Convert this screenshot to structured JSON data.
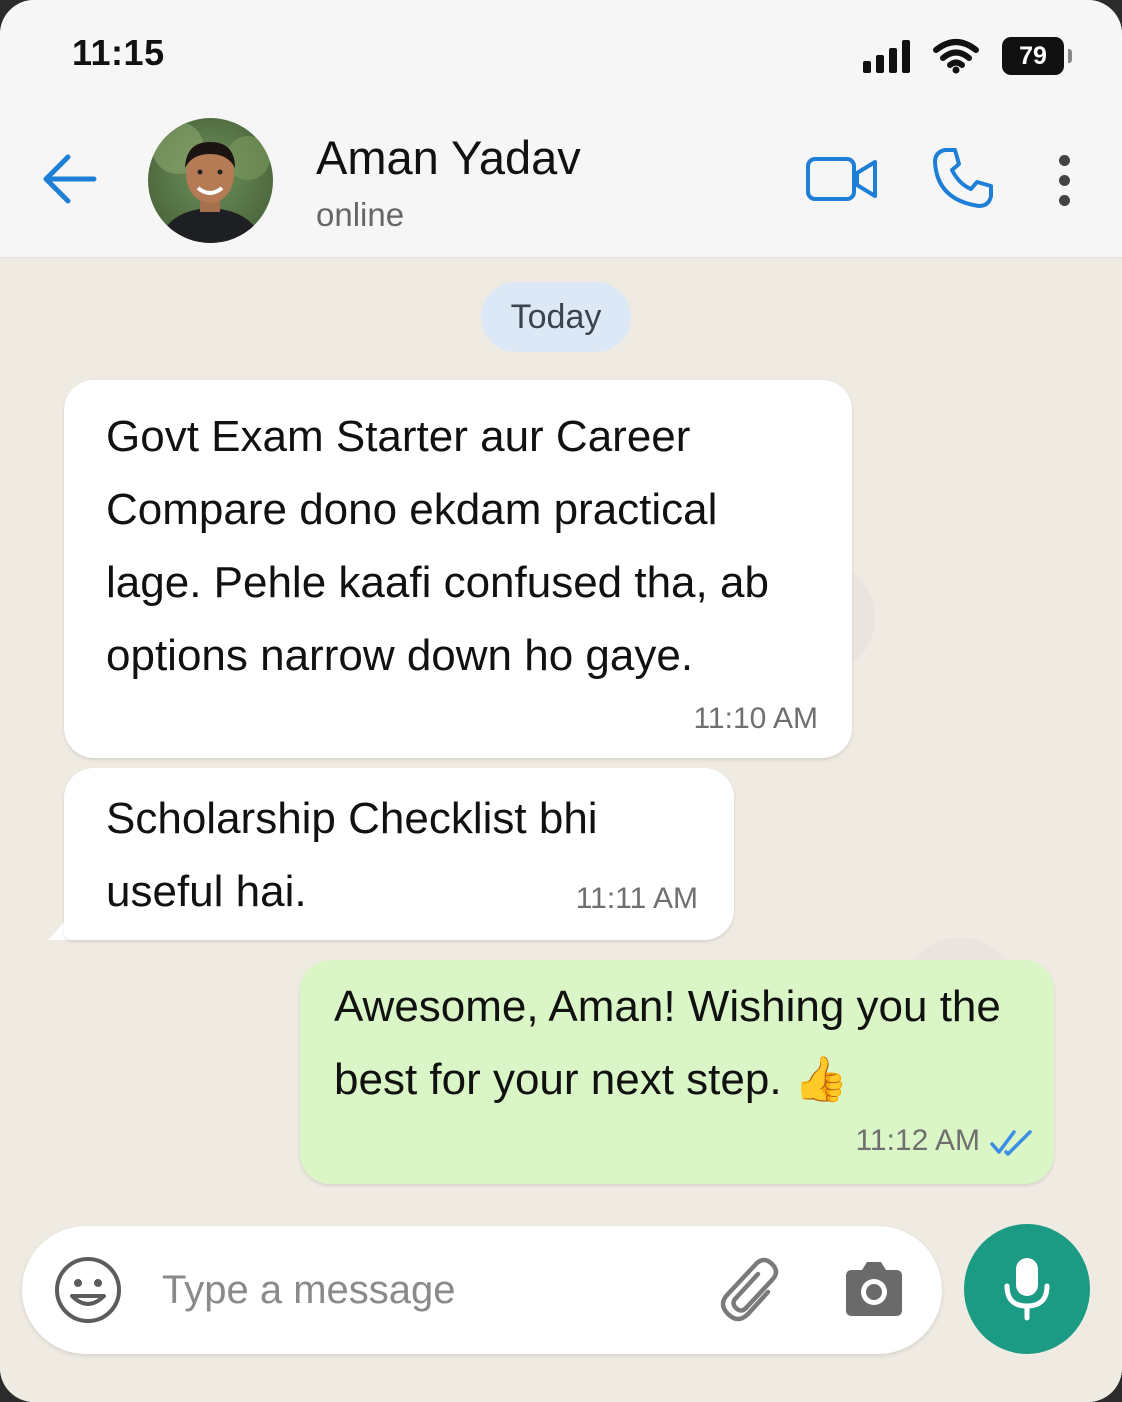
{
  "status_bar": {
    "time": "11:15",
    "battery": "79"
  },
  "header": {
    "contact_name": "Aman Yadav",
    "contact_status": "online"
  },
  "chat": {
    "date_label": "Today",
    "messages": [
      {
        "direction": "incoming",
        "lines": [
          "Govt Exam Starter aur Career",
          "Compare dono ekdam practical",
          "lage. Pehle kaafi confused tha, ab",
          "options narrow down ho gaye."
        ],
        "time": "11:10 AM"
      },
      {
        "direction": "incoming",
        "lines": [
          "Scholarship Checklist bhi",
          "useful hai."
        ],
        "time": "11:11 AM"
      },
      {
        "direction": "outgoing",
        "lines": [
          "Awesome, Aman! Wishing you the",
          "best for your next step. 👍"
        ],
        "time": "11:12 AM",
        "read": true
      }
    ]
  },
  "composer": {
    "placeholder": "Type a message"
  },
  "colors": {
    "accent_blue": "#1e7fd6",
    "outgoing_bubble": "#dbf6c6",
    "mic_button": "#1b9a84",
    "read_ticks": "#3a8ee6"
  },
  "icons": [
    "back-arrow-icon",
    "video-call-icon",
    "phone-icon",
    "more-vert-icon",
    "emoji-icon",
    "paperclip-icon",
    "camera-icon",
    "mic-icon",
    "double-check-icon"
  ]
}
